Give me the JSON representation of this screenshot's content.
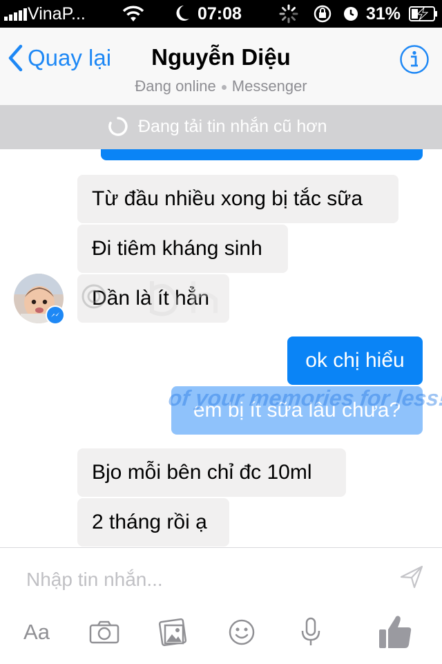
{
  "status_bar": {
    "carrier": "VinaP...",
    "time": "07:08",
    "battery": "31%",
    "signal_bars": 5,
    "battery_level": 0.31
  },
  "nav": {
    "back_label": "Quay lại",
    "contact_name": "Nguyễn Diệu",
    "status": "Đang online",
    "app": "Messenger"
  },
  "loading": {
    "text": "Đang tải tin nhắn cũ hơn"
  },
  "messages": [
    {
      "direction": "incoming",
      "text": "Từ đầu nhiều xong bị tắc sữa"
    },
    {
      "direction": "incoming",
      "text": "Đi tiêm kháng sinh"
    },
    {
      "direction": "incoming",
      "text": "Dần là ít hẳn"
    },
    {
      "direction": "outgoing",
      "text": "ok chị hiểu"
    },
    {
      "direction": "outgoing",
      "text": "em bị ít sữa lâu chưa?"
    },
    {
      "direction": "incoming",
      "text": "Bjo mỗi bên chỉ đc 10ml"
    },
    {
      "direction": "incoming",
      "text": "2 tháng rồi ạ"
    }
  ],
  "watermark": {
    "text": "of your memories for less!"
  },
  "compose": {
    "placeholder": "Nhập tin nhắn..."
  },
  "toolbar": {
    "text_format_label": "Aa",
    "icons": [
      "camera-icon",
      "photo-library-icon",
      "sticker-icon",
      "microphone-icon",
      "like-icon"
    ]
  },
  "colors": {
    "accent": "#1e88f5",
    "outgoing_bubble": "#0a84f6",
    "incoming_bubble": "#f1f0f0",
    "loading_banner": "#d2d2d4"
  }
}
